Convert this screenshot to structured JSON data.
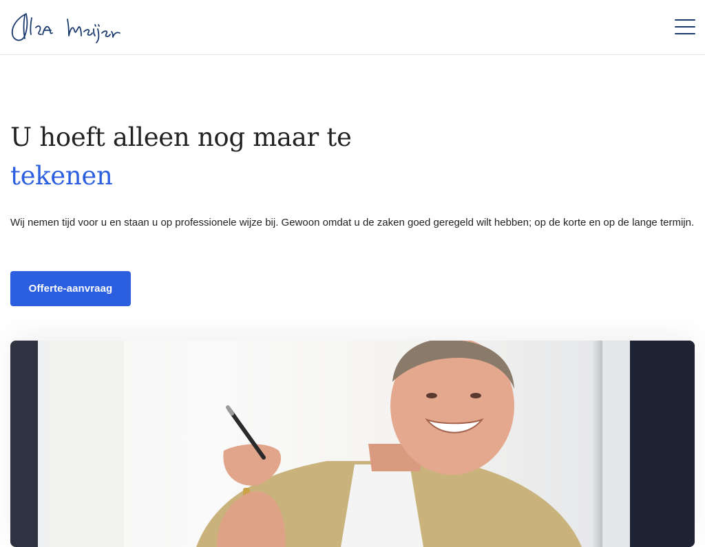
{
  "header": {
    "logo_alt": "Ilja Meijer handtekening",
    "menu_label": "Menu"
  },
  "hero": {
    "title_main": "U hoeft alleen nog maar te",
    "title_accent": "tekenen",
    "text": "Wij nemen tijd voor u en staan u op professionele wijze bij. Gewoon omdat u de zaken goed geregeld wilt hebben; op de korte en op de lange termijn.",
    "cta_label": "Offerte-aanvraag",
    "image_alt": "Lachende man in beige colbert met pen in de hand"
  },
  "colors": {
    "accent": "#2b5fe0",
    "logo": "#1a3a6e",
    "text": "#222222",
    "border": "#e3e3e3"
  },
  "icons": {
    "logo": "signature-logo",
    "menu": "hamburger-icon"
  }
}
